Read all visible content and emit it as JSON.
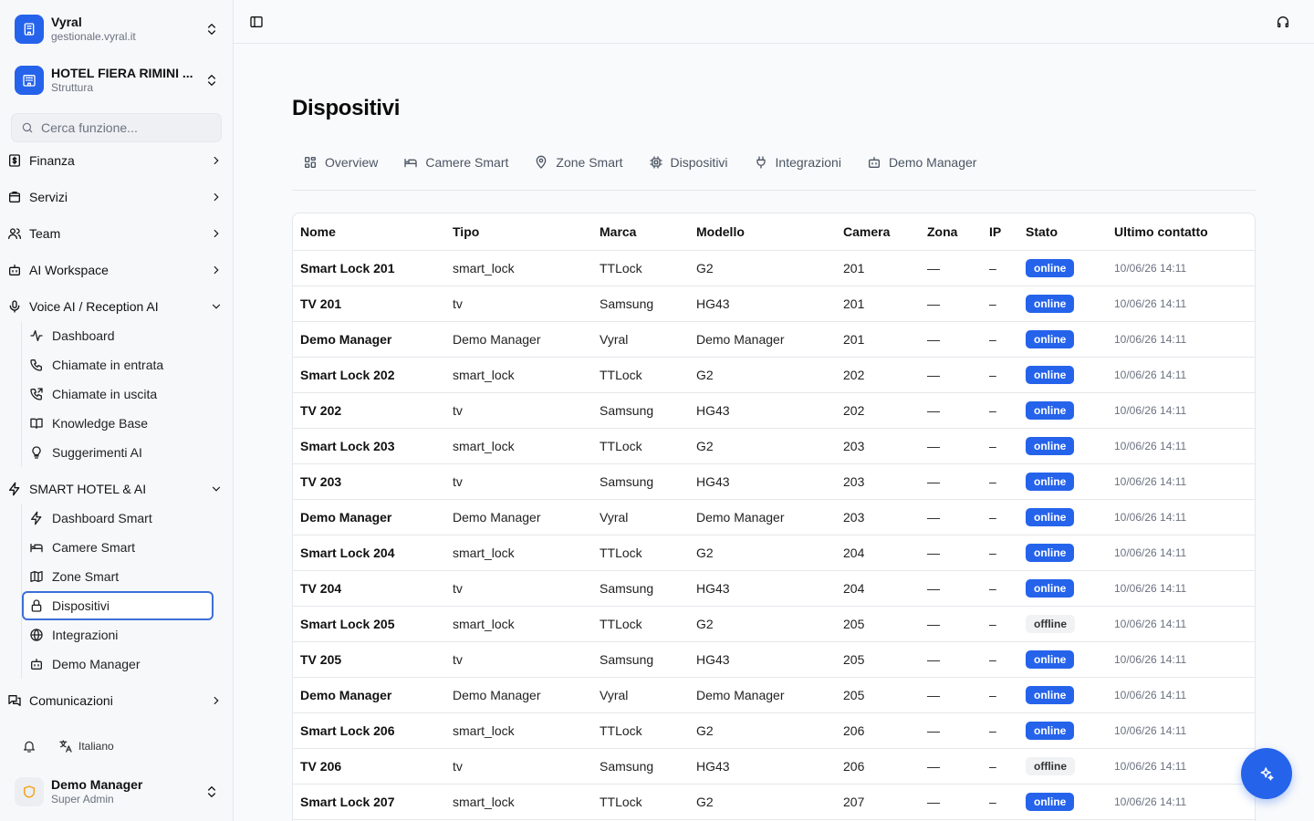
{
  "org": {
    "name": "Vyral",
    "domain": "gestionale.vyral.it",
    "icon": "building-icon"
  },
  "structure": {
    "name": "HOTEL FIERA RIMINI ...",
    "type": "Struttura",
    "icon": "hotel-icon"
  },
  "search": {
    "placeholder": "Cerca funzione..."
  },
  "nav": {
    "groups": [
      {
        "label": "Finanza",
        "icon": "finance-icon",
        "expanded": false
      },
      {
        "label": "Servizi",
        "icon": "shopping-bag-icon",
        "expanded": false
      },
      {
        "label": "Team",
        "icon": "users-icon",
        "expanded": false
      },
      {
        "label": "AI Workspace",
        "icon": "bot-icon",
        "expanded": false
      },
      {
        "label": "Voice AI / Reception AI",
        "icon": "microphone-icon",
        "expanded": true
      },
      {
        "label": "SMART HOTEL & AI",
        "icon": "lightning-icon",
        "expanded": true
      },
      {
        "label": "Comunicazioni",
        "icon": "messages-icon",
        "expanded": false
      }
    ],
    "voice_items": [
      {
        "label": "Dashboard",
        "icon": "activity-icon"
      },
      {
        "label": "Chiamate in entrata",
        "icon": "phone-icon"
      },
      {
        "label": "Chiamate in uscita",
        "icon": "phone-outgoing-icon"
      },
      {
        "label": "Knowledge Base",
        "icon": "book-icon"
      },
      {
        "label": "Suggerimenti AI",
        "icon": "lightbulb-icon"
      }
    ],
    "smart_items": [
      {
        "label": "Dashboard Smart",
        "icon": "lightning-icon"
      },
      {
        "label": "Camere Smart",
        "icon": "bed-icon"
      },
      {
        "label": "Zone Smart",
        "icon": "map-icon"
      },
      {
        "label": "Dispositivi",
        "icon": "lock-icon",
        "active": true
      },
      {
        "label": "Integrazioni",
        "icon": "globe-icon"
      },
      {
        "label": "Demo Manager",
        "icon": "bot-icon"
      }
    ]
  },
  "footer": {
    "language": "Italiano"
  },
  "user": {
    "name": "Demo Manager",
    "role": "Super Admin"
  },
  "page": {
    "title": "Dispositivi"
  },
  "tabs": [
    {
      "label": "Overview",
      "icon": "grid-icon"
    },
    {
      "label": "Camere Smart",
      "icon": "bed-icon"
    },
    {
      "label": "Zone Smart",
      "icon": "map-pin-icon"
    },
    {
      "label": "Dispositivi",
      "icon": "cpu-icon"
    },
    {
      "label": "Integrazioni",
      "icon": "plug-icon"
    },
    {
      "label": "Demo Manager",
      "icon": "bot-icon"
    }
  ],
  "table": {
    "columns": [
      "Nome",
      "Tipo",
      "Marca",
      "Modello",
      "Camera",
      "Zona",
      "IP",
      "Stato",
      "Ultimo contatto"
    ],
    "rows": [
      [
        "Smart Lock 201",
        "smart_lock",
        "TTLock",
        "G2",
        "201",
        "—",
        "–",
        "online",
        "10/06/26 14:11"
      ],
      [
        "TV 201",
        "tv",
        "Samsung",
        "HG43",
        "201",
        "—",
        "–",
        "online",
        "10/06/26 14:11"
      ],
      [
        "Demo Manager",
        "Demo Manager",
        "Vyral",
        "Demo Manager",
        "201",
        "—",
        "–",
        "online",
        "10/06/26 14:11"
      ],
      [
        "Smart Lock 202",
        "smart_lock",
        "TTLock",
        "G2",
        "202",
        "—",
        "–",
        "online",
        "10/06/26 14:11"
      ],
      [
        "TV 202",
        "tv",
        "Samsung",
        "HG43",
        "202",
        "—",
        "–",
        "online",
        "10/06/26 14:11"
      ],
      [
        "Smart Lock 203",
        "smart_lock",
        "TTLock",
        "G2",
        "203",
        "—",
        "–",
        "online",
        "10/06/26 14:11"
      ],
      [
        "TV 203",
        "tv",
        "Samsung",
        "HG43",
        "203",
        "—",
        "–",
        "online",
        "10/06/26 14:11"
      ],
      [
        "Demo Manager",
        "Demo Manager",
        "Vyral",
        "Demo Manager",
        "203",
        "—",
        "–",
        "online",
        "10/06/26 14:11"
      ],
      [
        "Smart Lock 204",
        "smart_lock",
        "TTLock",
        "G2",
        "204",
        "—",
        "–",
        "online",
        "10/06/26 14:11"
      ],
      [
        "TV 204",
        "tv",
        "Samsung",
        "HG43",
        "204",
        "—",
        "–",
        "online",
        "10/06/26 14:11"
      ],
      [
        "Smart Lock 205",
        "smart_lock",
        "TTLock",
        "G2",
        "205",
        "—",
        "–",
        "offline",
        "10/06/26 14:11"
      ],
      [
        "TV 205",
        "tv",
        "Samsung",
        "HG43",
        "205",
        "—",
        "–",
        "online",
        "10/06/26 14:11"
      ],
      [
        "Demo Manager",
        "Demo Manager",
        "Vyral",
        "Demo Manager",
        "205",
        "—",
        "–",
        "online",
        "10/06/26 14:11"
      ],
      [
        "Smart Lock 206",
        "smart_lock",
        "TTLock",
        "G2",
        "206",
        "—",
        "–",
        "online",
        "10/06/26 14:11"
      ],
      [
        "TV 206",
        "tv",
        "Samsung",
        "HG43",
        "206",
        "—",
        "–",
        "offline",
        "10/06/26 14:11"
      ],
      [
        "Smart Lock 207",
        "smart_lock",
        "TTLock",
        "G2",
        "207",
        "—",
        "–",
        "online",
        "10/06/26 14:11"
      ]
    ]
  },
  "colors": {
    "accent": "#2563eb",
    "border": "#e5e7eb",
    "sidebar_bg": "#f7f8fa",
    "offline_bg": "#f1f2f4"
  }
}
